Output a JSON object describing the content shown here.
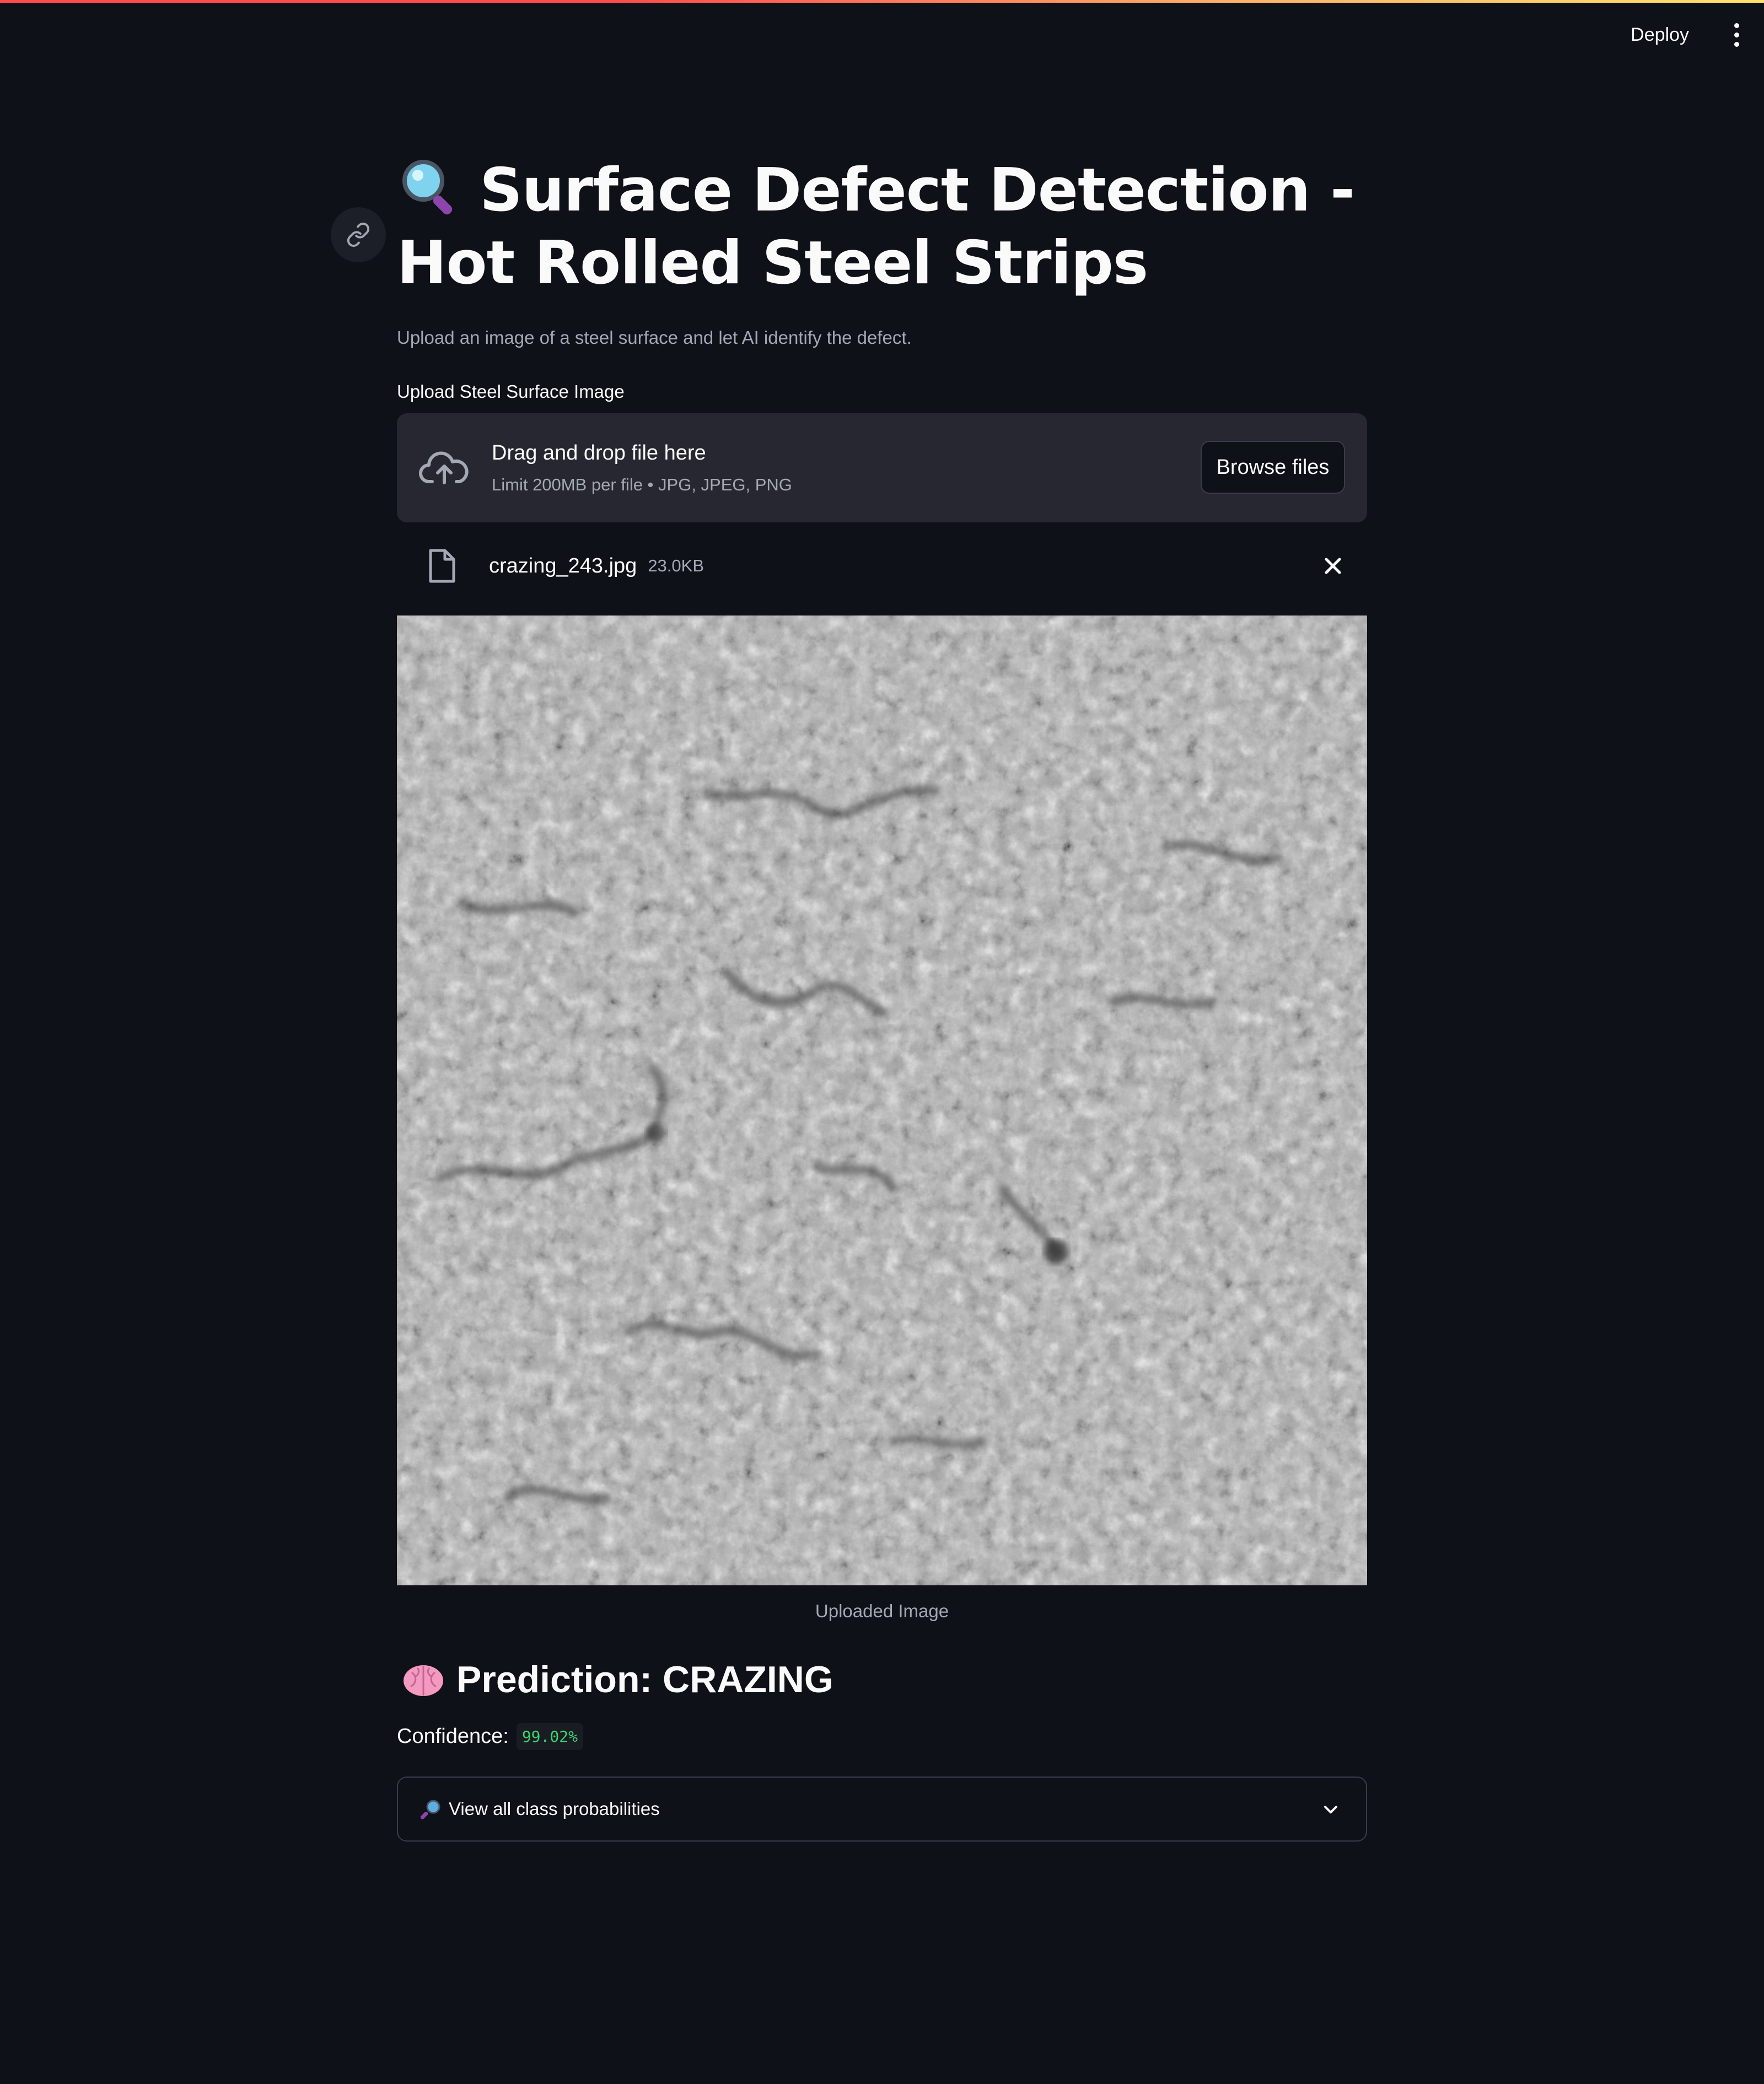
{
  "header": {
    "deploy_label": "Deploy",
    "menu_icon": "kebab-menu-icon"
  },
  "page": {
    "title": "Surface Defect Detection - Hot Rolled Steel Strips",
    "title_icon": "magnifying-glass-icon",
    "subtitle": "Upload an image of a steel surface and let AI identify the defect."
  },
  "uploader": {
    "label": "Upload Steel Surface Image",
    "drop_text": "Drag and drop file here",
    "limit_text": "Limit 200MB per file • JPG, JPEG, PNG",
    "browse_label": "Browse files"
  },
  "file": {
    "name": "crazing_243.jpg",
    "size": "23.0KB"
  },
  "image": {
    "caption": "Uploaded Image"
  },
  "result": {
    "prediction": "Prediction: CRAZING",
    "prediction_icon": "brain-icon",
    "confidence_label": "Confidence:",
    "confidence_value": "99.02%"
  },
  "expander": {
    "label": "View all class probabilities",
    "icon": "magnifying-glass-icon"
  },
  "colors": {
    "background": "#0e1117",
    "accent_red": "#ff4b4b",
    "confidence_green": "#3dd56d"
  }
}
